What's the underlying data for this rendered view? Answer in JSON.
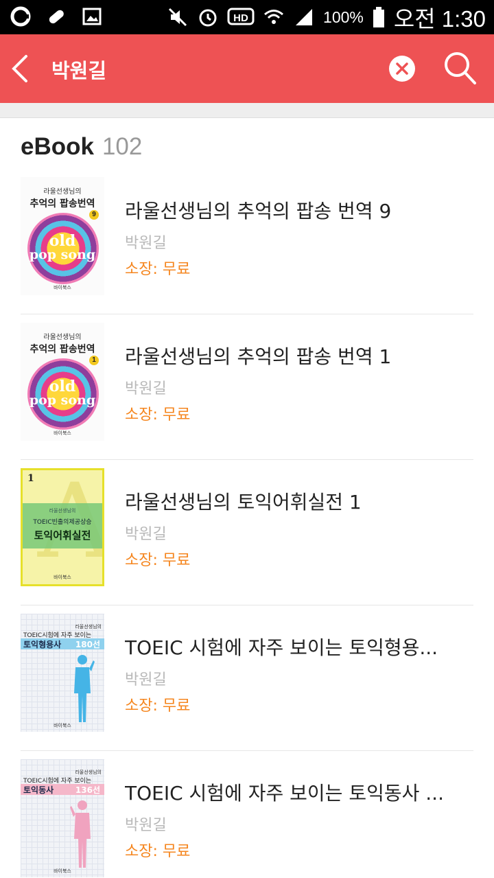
{
  "status_bar": {
    "battery": "100%",
    "time": "오전 1:30",
    "icons": [
      "app-icon",
      "medication-icon",
      "gallery-icon",
      "mute-icon",
      "alarm-icon",
      "hd-icon",
      "wifi-icon",
      "signal-icon",
      "battery-icon"
    ]
  },
  "header": {
    "search_query": "박원길",
    "back_icon": "chevron-left-icon",
    "clear_icon": "clear-icon",
    "search_icon": "search-icon",
    "background_color": "#ee5254"
  },
  "section": {
    "label": "eBook",
    "count": "102"
  },
  "books": [
    {
      "title": "라울선생님의 추억의 팝송 번역 9",
      "author": "박원길",
      "price": "소장: 무료",
      "cover": {
        "line1": "라울선생님의",
        "line2": "추억의 팝송번역",
        "volume": "9",
        "text1": "old",
        "text2": "pop song",
        "publisher": "바이북스"
      }
    },
    {
      "title": "라울선생님의 추억의 팝송 번역 1",
      "author": "박원길",
      "price": "소장: 무료",
      "cover": {
        "line1": "라울선생님의",
        "line2": "추억의 팝송번역",
        "volume": "1",
        "text1": "old",
        "text2": "pop song",
        "publisher": "바이북스"
      }
    },
    {
      "title": "라울선생님의 토익어휘실전 1",
      "author": "박원길",
      "price": "소장: 무료",
      "cover": {
        "volume": "1",
        "line1": "라울선생님의",
        "line2": "TOEIC빈출의제공상승",
        "line3": "토익어휘실전",
        "publisher": "바이북스"
      }
    },
    {
      "title": "TOEIC 시험에 자주 보이는 토익형용...",
      "author": "박원길",
      "price": "소장: 무료",
      "cover": {
        "line1": "라울선생님의",
        "line2": "TOEIC시험에 자주 보이는",
        "line3": "토익형용사",
        "line4": "180선",
        "publisher": "바이북스"
      }
    },
    {
      "title": "TOEIC 시험에 자주 보이는 토익동사 ...",
      "author": "박원길",
      "price": "소장: 무료",
      "cover": {
        "line1": "라울선생님의",
        "line2": "TOEIC시험에 자주 보이는",
        "line3": "토익동사",
        "line4": "136선",
        "publisher": "바이북스"
      }
    }
  ]
}
